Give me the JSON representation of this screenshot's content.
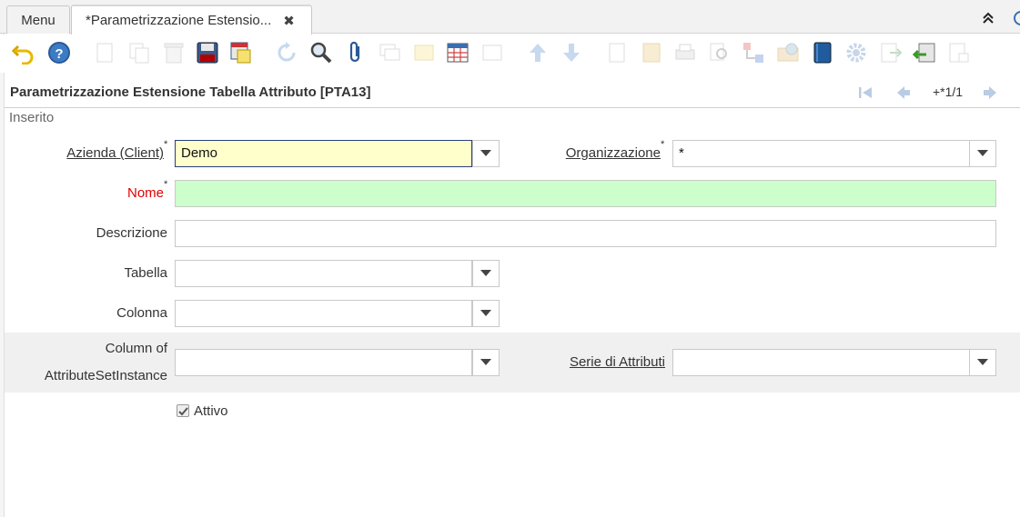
{
  "tabs": {
    "menu_label": "Menu",
    "active_label": "*Parametrizzazione Estensio...",
    "close_glyph": "✖"
  },
  "window": {
    "title": "Parametrizzazione Estensione Tabella Attributo [PTA13]",
    "record_indicator": "+*1/1",
    "status": "Inserito"
  },
  "form": {
    "azienda_label": "Azienda (Client)",
    "azienda_value": "Demo",
    "organizzazione_label": "Organizzazione",
    "organizzazione_value": "*",
    "nome_label": "Nome",
    "nome_value": "",
    "descrizione_label": "Descrizione",
    "descrizione_value": "",
    "tabella_label": "Tabella",
    "tabella_value": "",
    "colonna_label": "Colonna",
    "colonna_value": "",
    "column_asi_label_1": "Column of",
    "column_asi_label_2": "AttributeSetInstance",
    "column_asi_value": "",
    "serie_label": "Serie di Attributi",
    "serie_value": "",
    "attivo_label": "Attivo",
    "attivo_checked": true,
    "required_mark": "*"
  },
  "colors": {
    "mandatory_bg": "#ffffcc",
    "required_bg": "#ccffcc",
    "required_label": "#e00000"
  }
}
